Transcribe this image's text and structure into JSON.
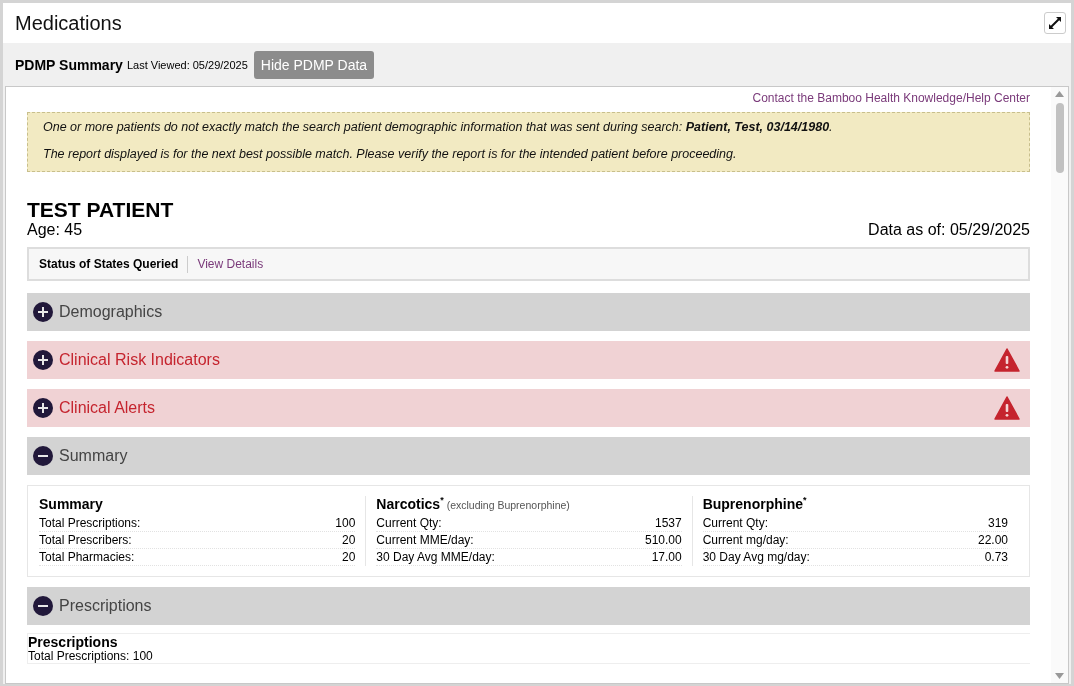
{
  "window": {
    "title": "Medications"
  },
  "subheader": {
    "title": "PDMP Summary",
    "last_viewed": "Last Viewed: 05/29/2025",
    "button": "Hide PDMP Data"
  },
  "help_link": "Contact the Bamboo Health Knowledge/Help Center",
  "notice": [
    "One or more patients do not exactly match the search patient demographic information that was sent during search: **Patient, Test, 03/14/1980**.",
    "The report displayed is for the next best possible match. Please verify the report is for the intended patient before proceeding."
  ],
  "patient": {
    "name": "TEST PATIENT",
    "age": "Age: 45",
    "data_as_of": "Data as of: 05/29/2025"
  },
  "states_bar": {
    "label": "Status of States Queried",
    "link": "View Details"
  },
  "sections": [
    {
      "title": "Demographics",
      "expanded": false,
      "alert": false
    },
    {
      "title": "Clinical Risk Indicators",
      "expanded": false,
      "alert": true
    },
    {
      "title": "Clinical Alerts",
      "expanded": false,
      "alert": true
    },
    {
      "title": "Summary",
      "expanded": true,
      "alert": false,
      "kind": "summary",
      "columns": [
        {
          "title": "Summary",
          "rows": [
            {
              "label": "Total Prescriptions:",
              "value": "100"
            },
            {
              "label": "Total Prescribers:",
              "value": "20"
            },
            {
              "label": "Total Pharmacies:",
              "value": "20"
            }
          ]
        },
        {
          "title": "Narcotics$^{*}$",
          "note": "(excluding Buprenorphine)",
          "rows": [
            {
              "label": "Current Qty:",
              "value": "1537"
            },
            {
              "label": "Current MME/day:",
              "value": "510.00"
            },
            {
              "label": "30 Day Avg MME/day:",
              "value": "17.00"
            }
          ]
        },
        {
          "title": "Buprenorphine$^{*}$",
          "rows": [
            {
              "label": "Current Qty:",
              "value": "319"
            },
            {
              "label": "Current mg/day:",
              "value": "22.00"
            },
            {
              "label": "30 Day Avg mg/day:",
              "value": "0.73"
            }
          ]
        }
      ]
    },
    {
      "title": "Prescriptions",
      "expanded": true,
      "alert": false,
      "kind": "prescriptions",
      "heading": "Prescriptions",
      "total": "Total Prescriptions: 100"
    }
  ]
}
